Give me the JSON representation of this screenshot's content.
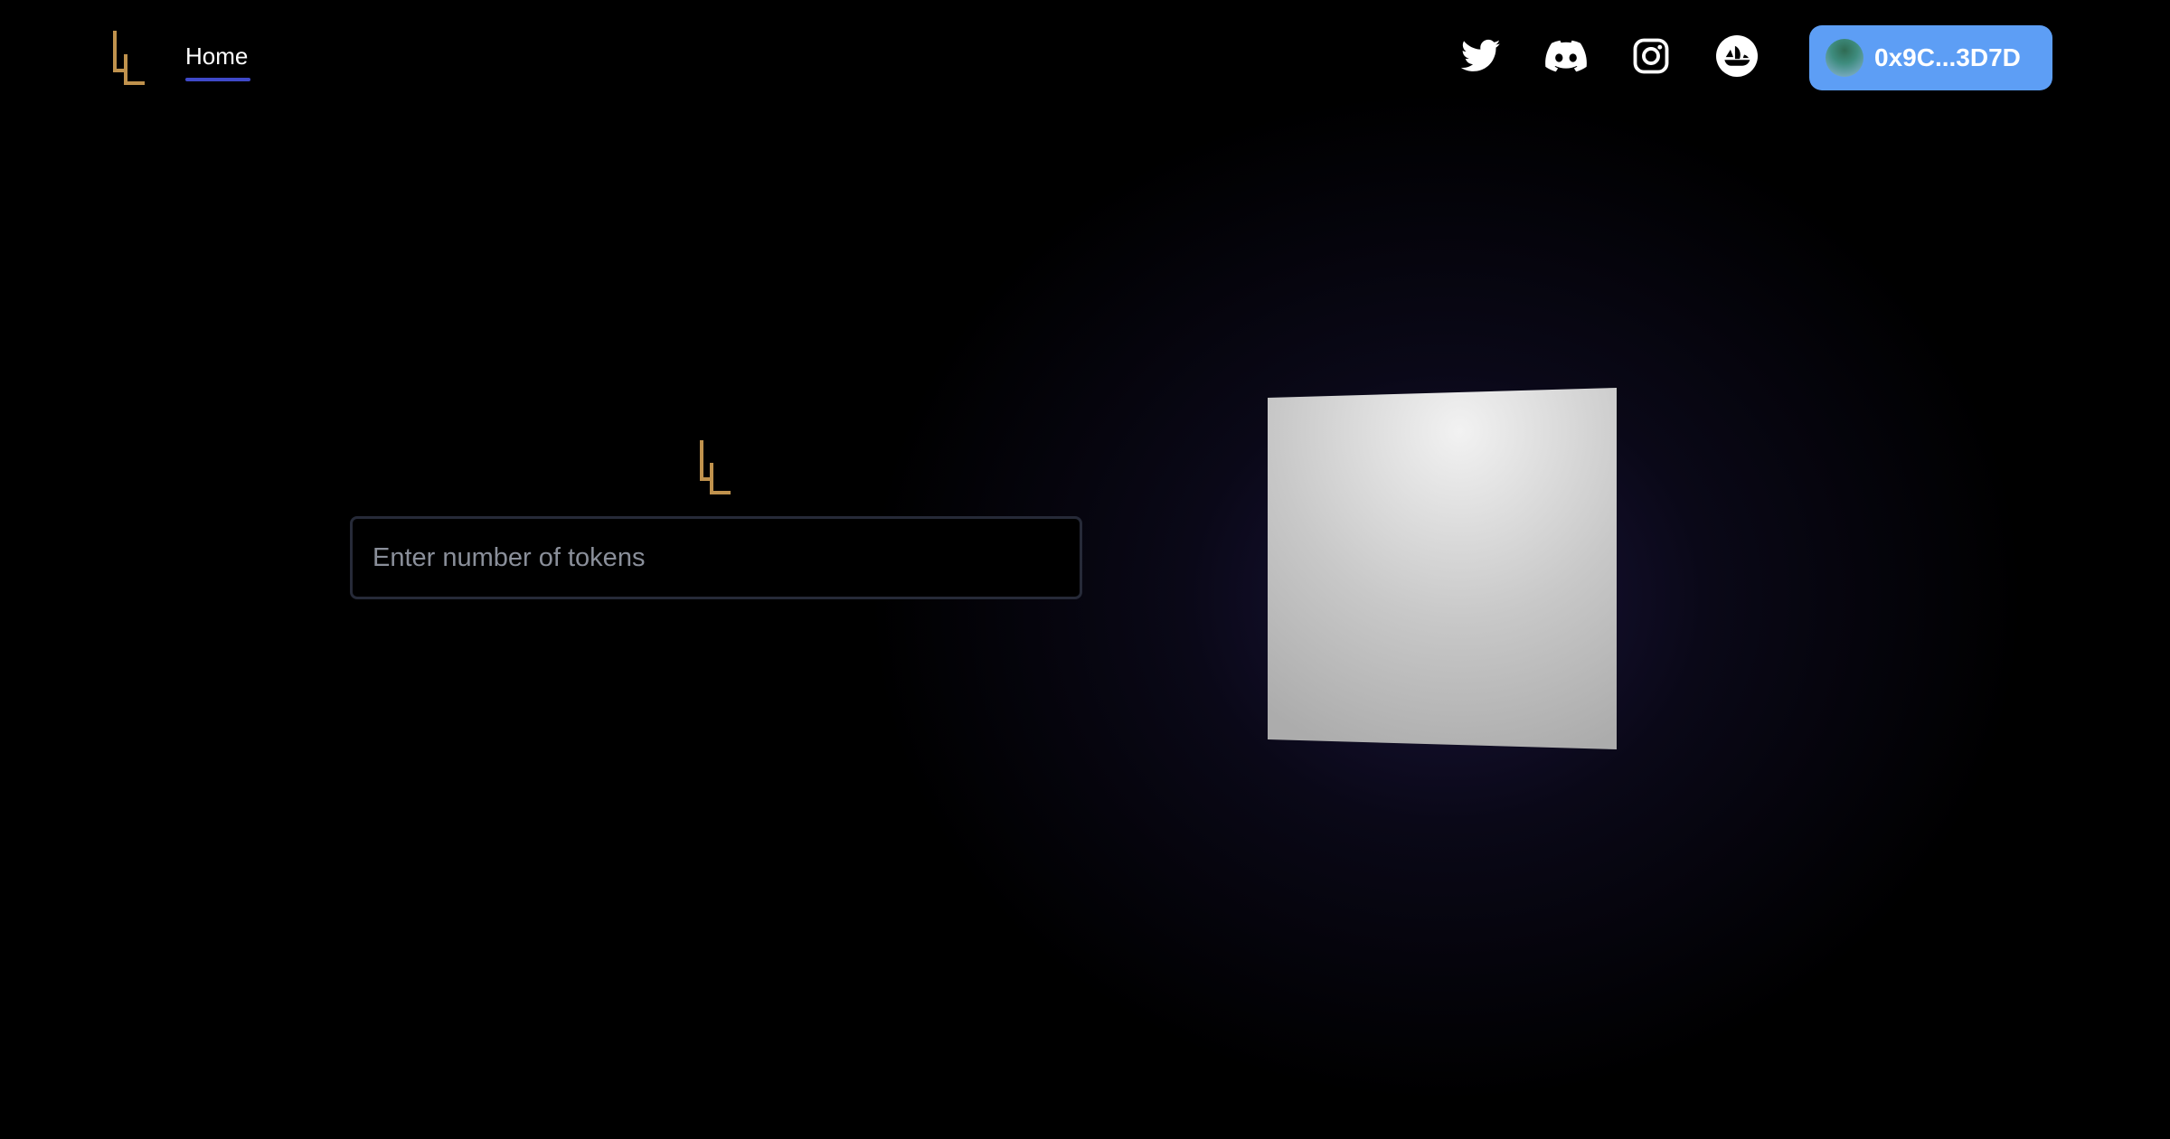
{
  "nav": {
    "home_label": "Home"
  },
  "social_links": [
    {
      "name": "twitter-icon"
    },
    {
      "name": "discord-icon"
    },
    {
      "name": "instagram-icon"
    },
    {
      "name": "opensea-icon"
    }
  ],
  "wallet": {
    "address": "0x9C...3D7D"
  },
  "mint": {
    "placeholder": "Enter number of tokens"
  },
  "colors": {
    "accent_blue": "#5d9ef5",
    "logo_gold": "#c0924d",
    "nav_underline": "#3f49c9",
    "background": "#000000"
  }
}
